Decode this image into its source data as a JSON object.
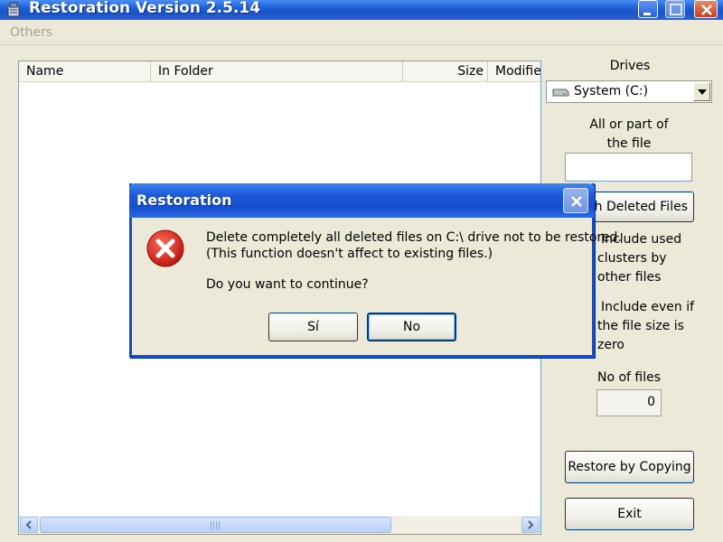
{
  "window": {
    "title": "Restoration Version 2.5.14"
  },
  "menu": {
    "items": [
      {
        "label": "Others"
      }
    ]
  },
  "file_list": {
    "columns": [
      {
        "label": "Name"
      },
      {
        "label": "In Folder"
      },
      {
        "label": "Size"
      },
      {
        "label": "Modified"
      }
    ],
    "rows": []
  },
  "panel": {
    "drives_label": "Drives",
    "drive_selected": "System (C:)",
    "file_filter_label_line1": "All or part of",
    "file_filter_label_line2": "the file",
    "file_filter_value": "",
    "search_button": "rch Deleted Files",
    "include_used_line1": "Include used",
    "include_used_line2": "clusters by",
    "include_used_line3": "other files",
    "include_even_line1": "Include even if",
    "include_even_line2": "the file size is",
    "include_even_line3": "zero",
    "no_of_files_label": "No of files",
    "no_of_files_value": "0",
    "restore_button": "Restore by Copying",
    "exit_button": "Exit"
  },
  "dialog": {
    "title": "Restoration",
    "icon": "error-icon",
    "message_line1": "Delete completely all deleted files on C:\\ drive not to be restored.",
    "message_line2": "(This function doesn't affect to existing files.)",
    "question": "Do you want to continue?",
    "yes_button": "Sí",
    "no_button": "No"
  },
  "colors": {
    "titlebar": "#1f5fd6",
    "face": "#ECE9D8",
    "error_red": "#d9261c"
  }
}
